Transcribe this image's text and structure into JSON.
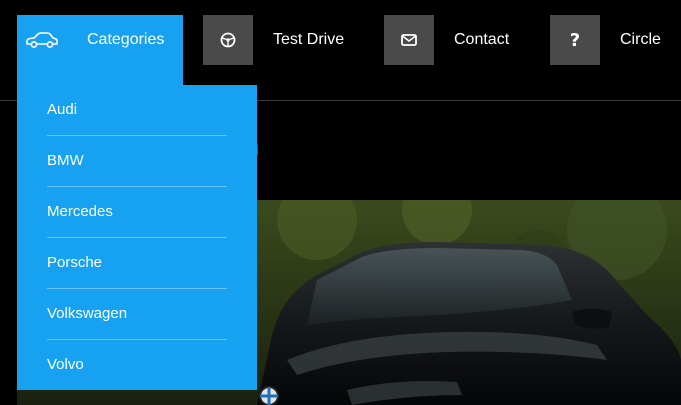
{
  "nav": {
    "categories": {
      "label": "Categories",
      "icon": "car-icon"
    },
    "test_drive": {
      "label": "Test Drive",
      "icon": "steering-wheel-icon"
    },
    "contact": {
      "label": "Contact",
      "icon": "envelope-icon"
    },
    "circle": {
      "label": "Circle",
      "icon": "question-icon",
      "glyph": "?"
    }
  },
  "dropdown": {
    "items": [
      {
        "label": "Audi"
      },
      {
        "label": "BMW"
      },
      {
        "label": "Mercedes"
      },
      {
        "label": "Porsche"
      },
      {
        "label": "Volkswagen"
      },
      {
        "label": "Volvo"
      }
    ]
  },
  "colors": {
    "accent": "#16a2f0",
    "icon_box": "#4a4a4a",
    "background": "#000000"
  }
}
